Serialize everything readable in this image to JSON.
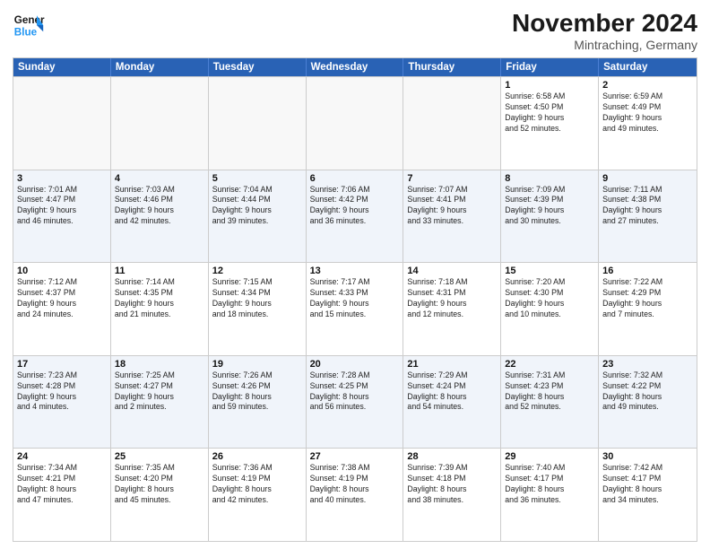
{
  "logo": {
    "line1": "General",
    "line2": "Blue"
  },
  "header": {
    "month_year": "November 2024",
    "location": "Mintraching, Germany"
  },
  "days_of_week": [
    "Sunday",
    "Monday",
    "Tuesday",
    "Wednesday",
    "Thursday",
    "Friday",
    "Saturday"
  ],
  "rows": [
    [
      {
        "day": "",
        "info": "",
        "empty": true
      },
      {
        "day": "",
        "info": "",
        "empty": true
      },
      {
        "day": "",
        "info": "",
        "empty": true
      },
      {
        "day": "",
        "info": "",
        "empty": true
      },
      {
        "day": "",
        "info": "",
        "empty": true
      },
      {
        "day": "1",
        "info": "Sunrise: 6:58 AM\nSunset: 4:50 PM\nDaylight: 9 hours\nand 52 minutes.",
        "empty": false
      },
      {
        "day": "2",
        "info": "Sunrise: 6:59 AM\nSunset: 4:49 PM\nDaylight: 9 hours\nand 49 minutes.",
        "empty": false
      }
    ],
    [
      {
        "day": "3",
        "info": "Sunrise: 7:01 AM\nSunset: 4:47 PM\nDaylight: 9 hours\nand 46 minutes.",
        "empty": false
      },
      {
        "day": "4",
        "info": "Sunrise: 7:03 AM\nSunset: 4:46 PM\nDaylight: 9 hours\nand 42 minutes.",
        "empty": false
      },
      {
        "day": "5",
        "info": "Sunrise: 7:04 AM\nSunset: 4:44 PM\nDaylight: 9 hours\nand 39 minutes.",
        "empty": false
      },
      {
        "day": "6",
        "info": "Sunrise: 7:06 AM\nSunset: 4:42 PM\nDaylight: 9 hours\nand 36 minutes.",
        "empty": false
      },
      {
        "day": "7",
        "info": "Sunrise: 7:07 AM\nSunset: 4:41 PM\nDaylight: 9 hours\nand 33 minutes.",
        "empty": false
      },
      {
        "day": "8",
        "info": "Sunrise: 7:09 AM\nSunset: 4:39 PM\nDaylight: 9 hours\nand 30 minutes.",
        "empty": false
      },
      {
        "day": "9",
        "info": "Sunrise: 7:11 AM\nSunset: 4:38 PM\nDaylight: 9 hours\nand 27 minutes.",
        "empty": false
      }
    ],
    [
      {
        "day": "10",
        "info": "Sunrise: 7:12 AM\nSunset: 4:37 PM\nDaylight: 9 hours\nand 24 minutes.",
        "empty": false
      },
      {
        "day": "11",
        "info": "Sunrise: 7:14 AM\nSunset: 4:35 PM\nDaylight: 9 hours\nand 21 minutes.",
        "empty": false
      },
      {
        "day": "12",
        "info": "Sunrise: 7:15 AM\nSunset: 4:34 PM\nDaylight: 9 hours\nand 18 minutes.",
        "empty": false
      },
      {
        "day": "13",
        "info": "Sunrise: 7:17 AM\nSunset: 4:33 PM\nDaylight: 9 hours\nand 15 minutes.",
        "empty": false
      },
      {
        "day": "14",
        "info": "Sunrise: 7:18 AM\nSunset: 4:31 PM\nDaylight: 9 hours\nand 12 minutes.",
        "empty": false
      },
      {
        "day": "15",
        "info": "Sunrise: 7:20 AM\nSunset: 4:30 PM\nDaylight: 9 hours\nand 10 minutes.",
        "empty": false
      },
      {
        "day": "16",
        "info": "Sunrise: 7:22 AM\nSunset: 4:29 PM\nDaylight: 9 hours\nand 7 minutes.",
        "empty": false
      }
    ],
    [
      {
        "day": "17",
        "info": "Sunrise: 7:23 AM\nSunset: 4:28 PM\nDaylight: 9 hours\nand 4 minutes.",
        "empty": false
      },
      {
        "day": "18",
        "info": "Sunrise: 7:25 AM\nSunset: 4:27 PM\nDaylight: 9 hours\nand 2 minutes.",
        "empty": false
      },
      {
        "day": "19",
        "info": "Sunrise: 7:26 AM\nSunset: 4:26 PM\nDaylight: 8 hours\nand 59 minutes.",
        "empty": false
      },
      {
        "day": "20",
        "info": "Sunrise: 7:28 AM\nSunset: 4:25 PM\nDaylight: 8 hours\nand 56 minutes.",
        "empty": false
      },
      {
        "day": "21",
        "info": "Sunrise: 7:29 AM\nSunset: 4:24 PM\nDaylight: 8 hours\nand 54 minutes.",
        "empty": false
      },
      {
        "day": "22",
        "info": "Sunrise: 7:31 AM\nSunset: 4:23 PM\nDaylight: 8 hours\nand 52 minutes.",
        "empty": false
      },
      {
        "day": "23",
        "info": "Sunrise: 7:32 AM\nSunset: 4:22 PM\nDaylight: 8 hours\nand 49 minutes.",
        "empty": false
      }
    ],
    [
      {
        "day": "24",
        "info": "Sunrise: 7:34 AM\nSunset: 4:21 PM\nDaylight: 8 hours\nand 47 minutes.",
        "empty": false
      },
      {
        "day": "25",
        "info": "Sunrise: 7:35 AM\nSunset: 4:20 PM\nDaylight: 8 hours\nand 45 minutes.",
        "empty": false
      },
      {
        "day": "26",
        "info": "Sunrise: 7:36 AM\nSunset: 4:19 PM\nDaylight: 8 hours\nand 42 minutes.",
        "empty": false
      },
      {
        "day": "27",
        "info": "Sunrise: 7:38 AM\nSunset: 4:19 PM\nDaylight: 8 hours\nand 40 minutes.",
        "empty": false
      },
      {
        "day": "28",
        "info": "Sunrise: 7:39 AM\nSunset: 4:18 PM\nDaylight: 8 hours\nand 38 minutes.",
        "empty": false
      },
      {
        "day": "29",
        "info": "Sunrise: 7:40 AM\nSunset: 4:17 PM\nDaylight: 8 hours\nand 36 minutes.",
        "empty": false
      },
      {
        "day": "30",
        "info": "Sunrise: 7:42 AM\nSunset: 4:17 PM\nDaylight: 8 hours\nand 34 minutes.",
        "empty": false
      }
    ]
  ]
}
